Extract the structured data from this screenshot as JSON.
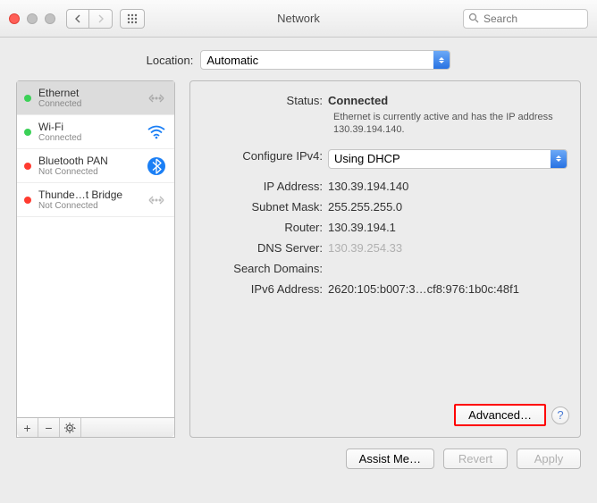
{
  "window": {
    "title": "Network",
    "search_placeholder": "Search"
  },
  "location": {
    "label": "Location:",
    "value": "Automatic"
  },
  "sidebar": {
    "items": [
      {
        "name": "Ethernet",
        "status": "Connected",
        "dot": "green",
        "icon": "ethernet",
        "selected": true
      },
      {
        "name": "Wi-Fi",
        "status": "Connected",
        "dot": "green",
        "icon": "wifi",
        "selected": false
      },
      {
        "name": "Bluetooth PAN",
        "status": "Not Connected",
        "dot": "red",
        "icon": "bluetooth",
        "selected": false
      },
      {
        "name": "Thunde…t Bridge",
        "status": "Not Connected",
        "dot": "red",
        "icon": "thunderbolt",
        "selected": false
      }
    ]
  },
  "detail": {
    "status_label": "Status:",
    "status_value": "Connected",
    "status_sub": "Ethernet is currently active and has the IP address 130.39.194.140.",
    "configure_label": "Configure IPv4:",
    "configure_value": "Using DHCP",
    "ip_label": "IP Address:",
    "ip_value": "130.39.194.140",
    "subnet_label": "Subnet Mask:",
    "subnet_value": "255.255.255.0",
    "router_label": "Router:",
    "router_value": "130.39.194.1",
    "dns_label": "DNS Server:",
    "dns_value": "130.39.254.33",
    "search_label": "Search Domains:",
    "search_value": "",
    "ipv6_label": "IPv6 Address:",
    "ipv6_value": "2620:105:b007:3…cf8:976:1b0c:48f1",
    "advanced_label": "Advanced…"
  },
  "buttons": {
    "assist": "Assist Me…",
    "revert": "Revert",
    "apply": "Apply"
  }
}
